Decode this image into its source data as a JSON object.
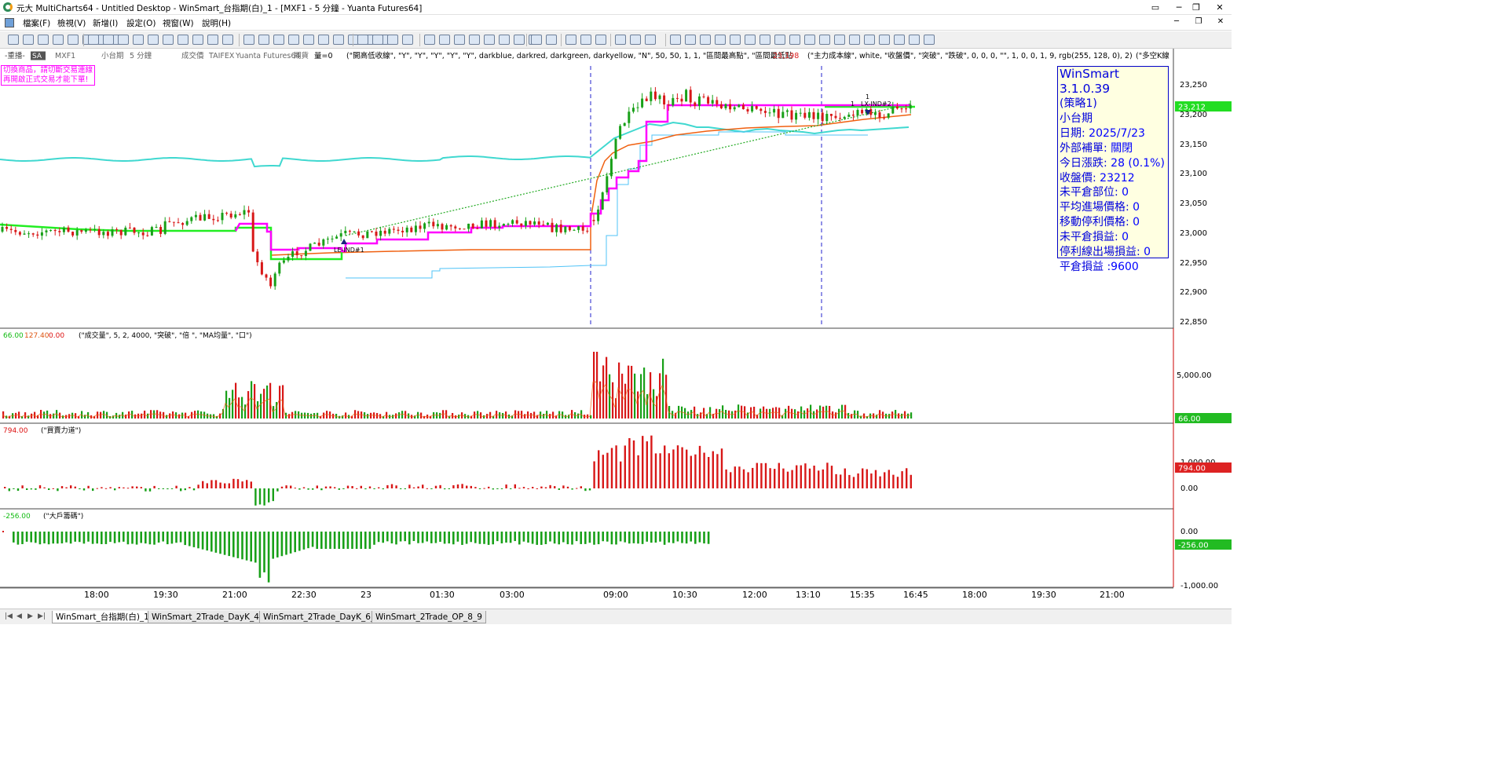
{
  "window": {
    "title": "元大 MultiCharts64 - Untitled Desktop - WinSmart_台指期(白)_1 - [MXF1 - 5 分鐘 - Yuanta Futures64]",
    "buttons": [
      "▭",
      "─",
      "❐",
      "✕"
    ],
    "mdi_buttons": [
      "─",
      "❐",
      "✕"
    ]
  },
  "menu": [
    "檔案(F)",
    "檢視(V)",
    "新增(I)",
    "設定(O)",
    "視窗(W)",
    "說明(H)"
  ],
  "price_pane": {
    "status_text": "-重播-",
    "symbol_badge": "SA",
    "symbol": "MXF1",
    "description": "小台期",
    "interval": "5 分鐘",
    "field": "成交價",
    "exchange": "TAIFEX",
    "datafeed": "Yuanta Futures64",
    "type": "期貨",
    "volume_label": "量=0",
    "study1": "(\"開高低收線\", \"Y\", \"Y\", \"Y\", \"Y\", \"Y\", darkblue, darkred, darkgreen, darkyellow, \"N\", 50, 50, 1, 1, \"區間最高點\", \"區間最低點",
    "study1_value": "23,198",
    "study2": "(\"主力成本線\", white, \"收盤價\", \"突破\", \"跌破\", 0, 0, 0, \"\", 1, 0, 0, 1, 9, rgb(255, 128, 0), 2)",
    "study3": "(\"多空K線",
    "y_ticks": [
      "23,250",
      "23,200",
      "23,150",
      "23,100",
      "23,050",
      "23,000",
      "22,950",
      "22,900",
      "22,850"
    ],
    "current_price_label": "23,212",
    "warning_lines": [
      "切換商品，請切斷交易連線",
      "再開啟正式交易才能下單!"
    ],
    "trade_labels": [
      "LE-IND#1",
      "1",
      "1",
      "LX-IND#2"
    ]
  },
  "info_box": {
    "title": "WinSmart 3.1.0.39",
    "strategy": "(策略1)",
    "product": "小台期",
    "date_label": "日期:",
    "date_value": "2025/7/23",
    "ext_label": "外部補單:",
    "ext_value": "關閉",
    "change_label": "今日漲跌:",
    "change_value": "28 (0.1%)",
    "close_label": "收盤價:",
    "close_value": "23212",
    "pos_label": "未平倉部位:",
    "pos_value": "0",
    "avg_label": "平均進場價格:",
    "avg_value": "0",
    "stop_label": "移動停利價格:",
    "stop_value": "0",
    "unreal_label": "未平倉損益:",
    "unreal_value": "0",
    "exit_label": "停利線出場損益:",
    "exit_value": "0",
    "real_label": "平倉損益 :",
    "real_value": "9600"
  },
  "volume_pane": {
    "v1": "66.00",
    "v2": "127.40",
    "v3": "0.00",
    "study": "(\"成交量\", 5, 2, 4000, \"突破\", \"倍 \", \"MA均量\", \"口\")",
    "y_tick": "5,000.00",
    "current_label": "66.00"
  },
  "force_pane": {
    "value": "794.00",
    "study": "(\"買賣力道\")",
    "y_ticks": [
      "1,000.00",
      "0.00"
    ],
    "current_label": "794.00"
  },
  "chip_pane": {
    "value": "-256.00",
    "study": "(\"大戶籌碼\")",
    "y_ticks": [
      "0.00",
      "-1,000.00"
    ],
    "current_label": "-256.00"
  },
  "time_axis": [
    "18:00",
    "19:30",
    "21:00",
    "22:30",
    "23",
    "01:30",
    "03:00",
    "09:00",
    "10:30",
    "12:00",
    "13:10",
    "15:35",
    "16:45",
    "18:00",
    "19:30",
    "21:00"
  ],
  "tabs": [
    "WinSmart_台指期(白)_1",
    "WinSmart_2Trade_DayK_4_5",
    "WinSmart_2Trade_DayK_6_7",
    "WinSmart_2Trade_OP_8_9"
  ],
  "colors": {
    "up": "#d81818",
    "down": "#18a018",
    "magenta": "#ff00ff",
    "lime": "#22ee22",
    "cyan": "#40d8d0",
    "orange": "#f06010",
    "info_text": "#0000dd",
    "label_green": "#11bb11",
    "label_red": "#dd1111"
  }
}
